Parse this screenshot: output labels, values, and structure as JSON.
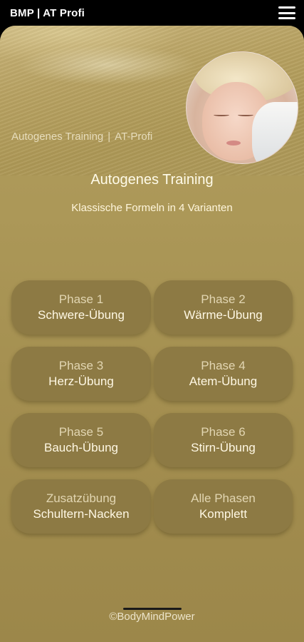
{
  "topbar": {
    "title": "BMP | AT Profi",
    "menu_icon": "hamburger-menu-icon"
  },
  "header": {
    "breadcrumb_left": "Autogenes Training",
    "breadcrumb_sep": "|",
    "breadcrumb_right": "AT-Profi",
    "portrait": "relaxing-woman-portrait"
  },
  "intro": {
    "title": "Autogenes Training",
    "subtitle": "Klassische Formeln in 4 Varianten"
  },
  "phases": [
    {
      "line1": "Phase 1",
      "line2": "Schwere-Übung"
    },
    {
      "line1": "Phase 2",
      "line2": "Wärme-Übung"
    },
    {
      "line1": "Phase 3",
      "line2": "Herz-Übung"
    },
    {
      "line1": "Phase 4",
      "line2": "Atem-Übung"
    },
    {
      "line1": "Phase 5",
      "line2": "Bauch-Übung"
    },
    {
      "line1": "Phase 6",
      "line2": "Stirn-Übung"
    },
    {
      "line1": "Zusatzübung",
      "line2": "Schultern-Nacken"
    },
    {
      "line1": "Alle Phasen",
      "line2": "Komplett"
    }
  ],
  "footer": {
    "copyright": "©BodyMindPower"
  },
  "colors": {
    "background": "#ac9858",
    "button": "#8d7a44",
    "text": "#fff8e4"
  }
}
